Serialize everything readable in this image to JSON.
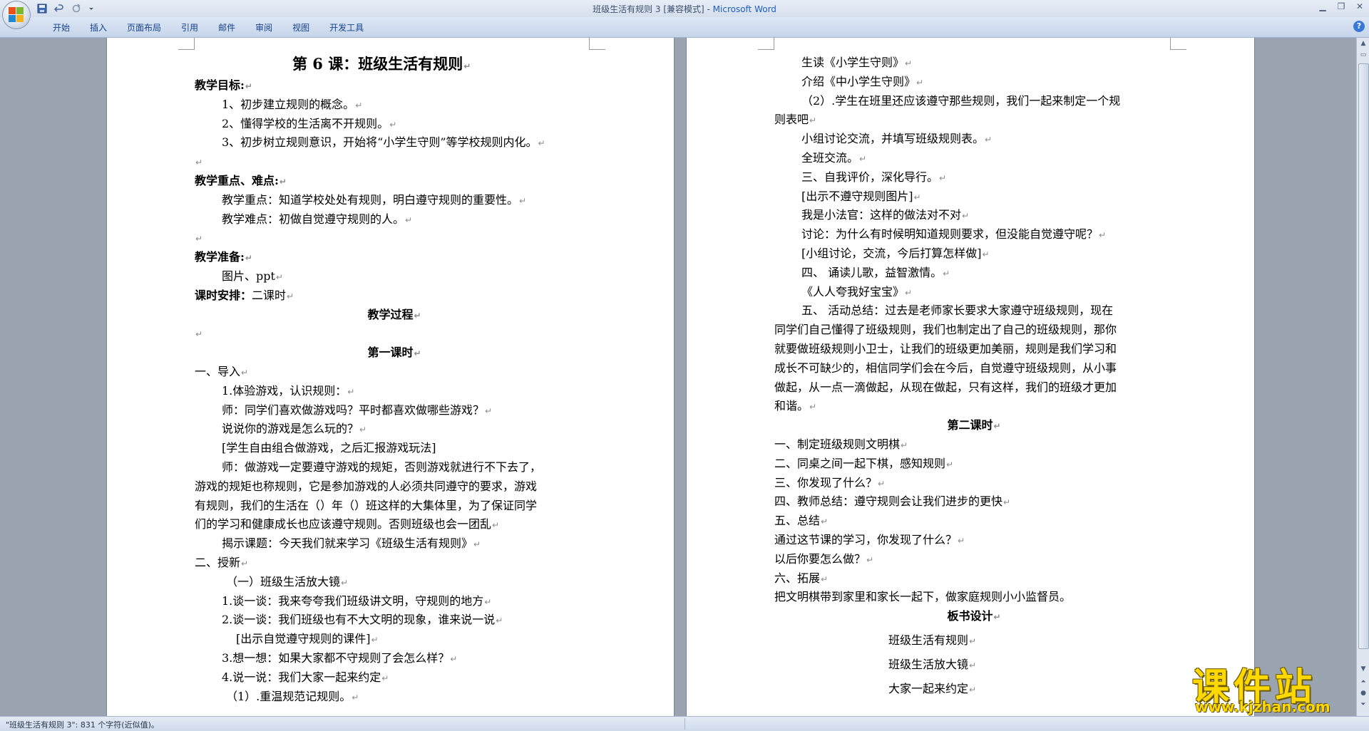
{
  "window": {
    "title_doc": "班级生活有规则 3 [兼容模式] - ",
    "title_app": "Microsoft Word"
  },
  "ribbon": {
    "tabs": [
      "开始",
      "插入",
      "页面布局",
      "引用",
      "邮件",
      "审阅",
      "视图",
      "开发工具"
    ],
    "help": "?"
  },
  "page1": {
    "title": "第 6 课：班级生活有规则",
    "lines": [
      {
        "t": "教学目标:",
        "h": true
      },
      {
        "t": "1、初步建立规则的概念。",
        "i": true
      },
      {
        "t": "2、懂得学校的生活离不开规则。",
        "i": true
      },
      {
        "t": "3、初步树立规则意识，开始将“小学生守则”等学校规则内化。",
        "i": true
      },
      {
        "t": "",
        "blank": true
      },
      {
        "t": "教学重点、难点:",
        "h": true
      },
      {
        "t": "教学重点：知道学校处处有规则，明白遵守规则的重要性。",
        "i": true
      },
      {
        "t": "教学难点：初做自觉遵守规则的人。",
        "i": true
      },
      {
        "t": "",
        "blank": true
      },
      {
        "t": "教学准备:",
        "h": true
      },
      {
        "t": "图片、ppt",
        "i": true
      },
      {
        "t": "课时安排：二课时",
        "hpart": "课时安排："
      },
      {
        "t": "教学过程",
        "h": true,
        "c": true
      },
      {
        "t": "",
        "blank": true,
        "cm": true
      },
      {
        "t": "第一课时",
        "h": true,
        "c": true
      },
      {
        "t": "一、导入"
      },
      {
        "t": "1.体验游戏，认识规则：",
        "i": true
      },
      {
        "t": "师：同学们喜欢做游戏吗？平时都喜欢做哪些游戏？",
        "i": true
      },
      {
        "t": "说说你的游戏是怎么玩的？",
        "i": true
      },
      {
        "t": "[学生自由组合做游戏，之后汇报游戏玩法]",
        "i": true,
        "nomark": true
      },
      {
        "t": "师：做游戏一定要遵守游戏的规矩，否则游戏就进行不下去了，",
        "i": true,
        "nomark": true
      },
      {
        "t": "游戏的规矩也称规则，它是参加游戏的人必须共同遵守的要求，游戏",
        "nomark": true
      },
      {
        "t": "有规则，我们的生活在（）年（）班这样的大集体里，为了保证同学",
        "nomark": true
      },
      {
        "t": "们的学习和健康成长也应该遵守规则。否则班级也会一团乱"
      },
      {
        "t": "揭示课题：今天我们就来学习《班级生活有规则》",
        "i": true
      },
      {
        "t": "二、授新"
      },
      {
        "t": "（一）班级生活放大镜",
        "i2": true
      },
      {
        "t": "1.谈一谈：我来夸夸我们班级讲文明，守规则的地方",
        "i": true
      },
      {
        "t": "2.谈一谈：我们班级也有不大文明的现象，谁来说一说",
        "i": true
      },
      {
        "t": "[出示自觉遵守规则的课件]",
        "i3": true
      },
      {
        "t": "3.想一想：如果大家都不守规则了会怎么样？",
        "i": true
      },
      {
        "t": "4.说一说：我们大家一起来约定",
        "i": true
      },
      {
        "t": "（1）.重温规范记规则。",
        "i2": true
      }
    ]
  },
  "page2": {
    "lines": [
      {
        "t": "生读《小学生守则》",
        "i": true
      },
      {
        "t": "介绍《中小学生守则》",
        "i": true
      },
      {
        "t": "（2）.学生在班里还应该遵守那些规则，我们一起来制定一个规",
        "i": true,
        "nomark": true
      },
      {
        "t": "则表吧"
      },
      {
        "t": "小组讨论交流，并填写班级规则表。",
        "i": true
      },
      {
        "t": "全班交流。",
        "i": true
      },
      {
        "t": "三、自我评价，深化导行。",
        "i": true
      },
      {
        "t": "[出示不遵守规则图片]",
        "i": true
      },
      {
        "t": "我是小法官：这样的做法对不对",
        "i": true
      },
      {
        "t": "讨论：为什么有时候明知道规则要求，但没能自觉遵守呢？",
        "i": true
      },
      {
        "t": "[小组讨论，交流，今后打算怎样做]",
        "i": true
      },
      {
        "t": "四、    诵读儿歌，益智激情。",
        "i": true
      },
      {
        "t": "《人人夸我好宝宝》",
        "i": true
      },
      {
        "t": "五、 活动总结：过去是老师家长要求大家遵守班级规则，现在",
        "i": true,
        "nomark": true
      },
      {
        "t": "同学们自己懂得了班级规则，我们也制定出了自己的班级规则，那你",
        "nomark": true
      },
      {
        "t": "就要做班级规则小卫士，让我们的班级更加美丽，规则是我们学习和",
        "nomark": true
      },
      {
        "t": "成长不可缺少的，相信同学们会在今后，自觉遵守班级规则，从小事",
        "nomark": true
      },
      {
        "t": "做起，从一点一滴做起，从现在做起，只有这样，我们的班级才更加",
        "nomark": true
      },
      {
        "t": "和谐。"
      },
      {
        "t": "第二课时",
        "h": true,
        "c": true
      },
      {
        "t": "一、制定班级规则文明棋"
      },
      {
        "t": "二、同桌之间一起下棋，感知规则"
      },
      {
        "t": "三、你发现了什么？"
      },
      {
        "t": "四、教师总结：遵守规则会让我们进步的更快"
      },
      {
        "t": "五、总结"
      },
      {
        "t": "通过这节课的学习，你发现了什么？"
      },
      {
        "t": "以后你要怎么做？"
      },
      {
        "t": "六、拓展"
      },
      {
        "t": "把文明棋带到家里和家长一起下，做家庭规则小小监督员。",
        "nomark": true
      },
      {
        "t": "板书设计",
        "h": true,
        "c": true
      }
    ],
    "board": [
      "班级生活有规则",
      "班级生活放大镜",
      "大家一起来约定"
    ]
  },
  "status": {
    "text": "\"班级生活有规则 3\": 831 个字符(近似值)。"
  },
  "watermark": {
    "title": "课件站",
    "url": "www.kjzhan.com"
  },
  "colors": {
    "workspace": "#9aa4b1",
    "ribbon_text": "#15428b",
    "watermark": "#ffd800"
  }
}
